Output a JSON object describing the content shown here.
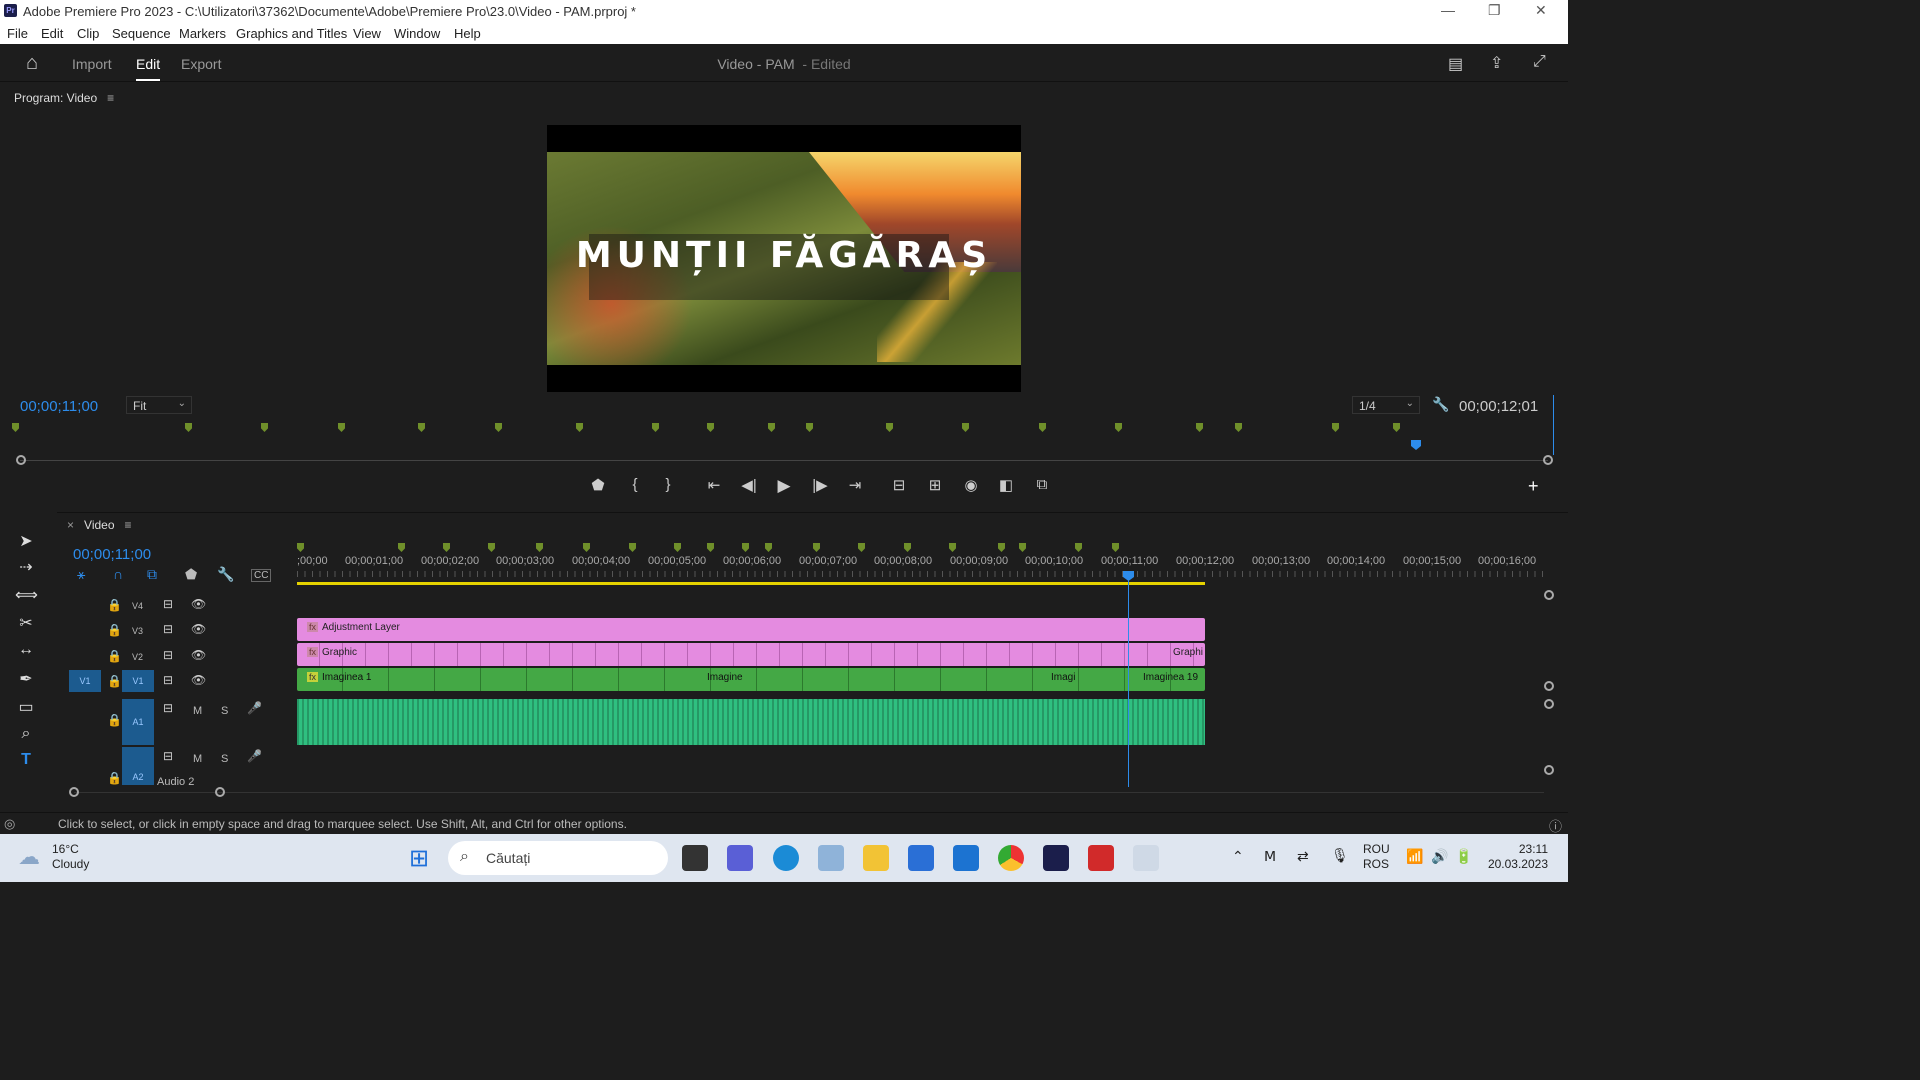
{
  "window": {
    "title": "Adobe Premiere Pro 2023 - C:\\Utilizatori\\37362\\Documente\\Adobe\\Premiere Pro\\23.0\\Video - PAM.prproj *",
    "app_icon": "Pr"
  },
  "menu": [
    "File",
    "Edit",
    "Clip",
    "Sequence",
    "Markers",
    "Graphics and Titles",
    "View",
    "Window",
    "Help"
  ],
  "header": {
    "tabs": [
      "Import",
      "Edit",
      "Export"
    ],
    "active_tab": "Edit",
    "project": "Video - PAM",
    "project_state": "- Edited"
  },
  "program": {
    "label": "Program: Video",
    "video_title": "MUNȚII FĂGĂRAȘ",
    "timecode": "00;00;11;00",
    "fit": "Fit",
    "quality": "1/4",
    "duration": "00;00;12;01"
  },
  "timeline": {
    "sequence": "Video",
    "timecode": "00;00;11;00",
    "ruler": [
      ";00;00",
      "00;00;01;00",
      "00;00;02;00",
      "00;00;03;00",
      "00;00;04;00",
      "00;00;05;00",
      "00;00;06;00",
      "00;00;07;00",
      "00;00;08;00",
      "00;00;09;00",
      "00;00;10;00",
      "00;00;11;00",
      "00;00;12;00",
      "00;00;13;00",
      "00;00;14;00",
      "00;00;15;00",
      "00;00;16;00"
    ],
    "tracks": {
      "v4": "V4",
      "v3": "V3",
      "v2": "V2",
      "v1": "V1",
      "v1src": "V1",
      "a1": "A1",
      "a2": "A2",
      "audio2": "Audio 2",
      "m": "M",
      "s": "S"
    },
    "clips": {
      "adjustment": "Adjustment Layer",
      "graphic": "Graphic",
      "graphic_end": "Graphi",
      "img1": "Imaginea 1",
      "img_mid": "Imagine",
      "img_short": "Imagi",
      "img19": "Imaginea 19",
      "fx": "fx"
    }
  },
  "status": {
    "text": "Click to select, or click in empty space and drag to marquee select. Use Shift, Alt, and Ctrl for other options."
  },
  "taskbar": {
    "temp": "16°C",
    "weather": "Cloudy",
    "search": "Căutați",
    "lang1": "ROU",
    "lang2": "ROS",
    "time": "23:11",
    "date": "20.03.2023"
  },
  "colors": {
    "accent": "#2d8ceb",
    "graphic_clip": "#e48be0",
    "video_clip": "#44a845",
    "audio_clip": "#2fbf80",
    "workarea": "#e5d200"
  }
}
